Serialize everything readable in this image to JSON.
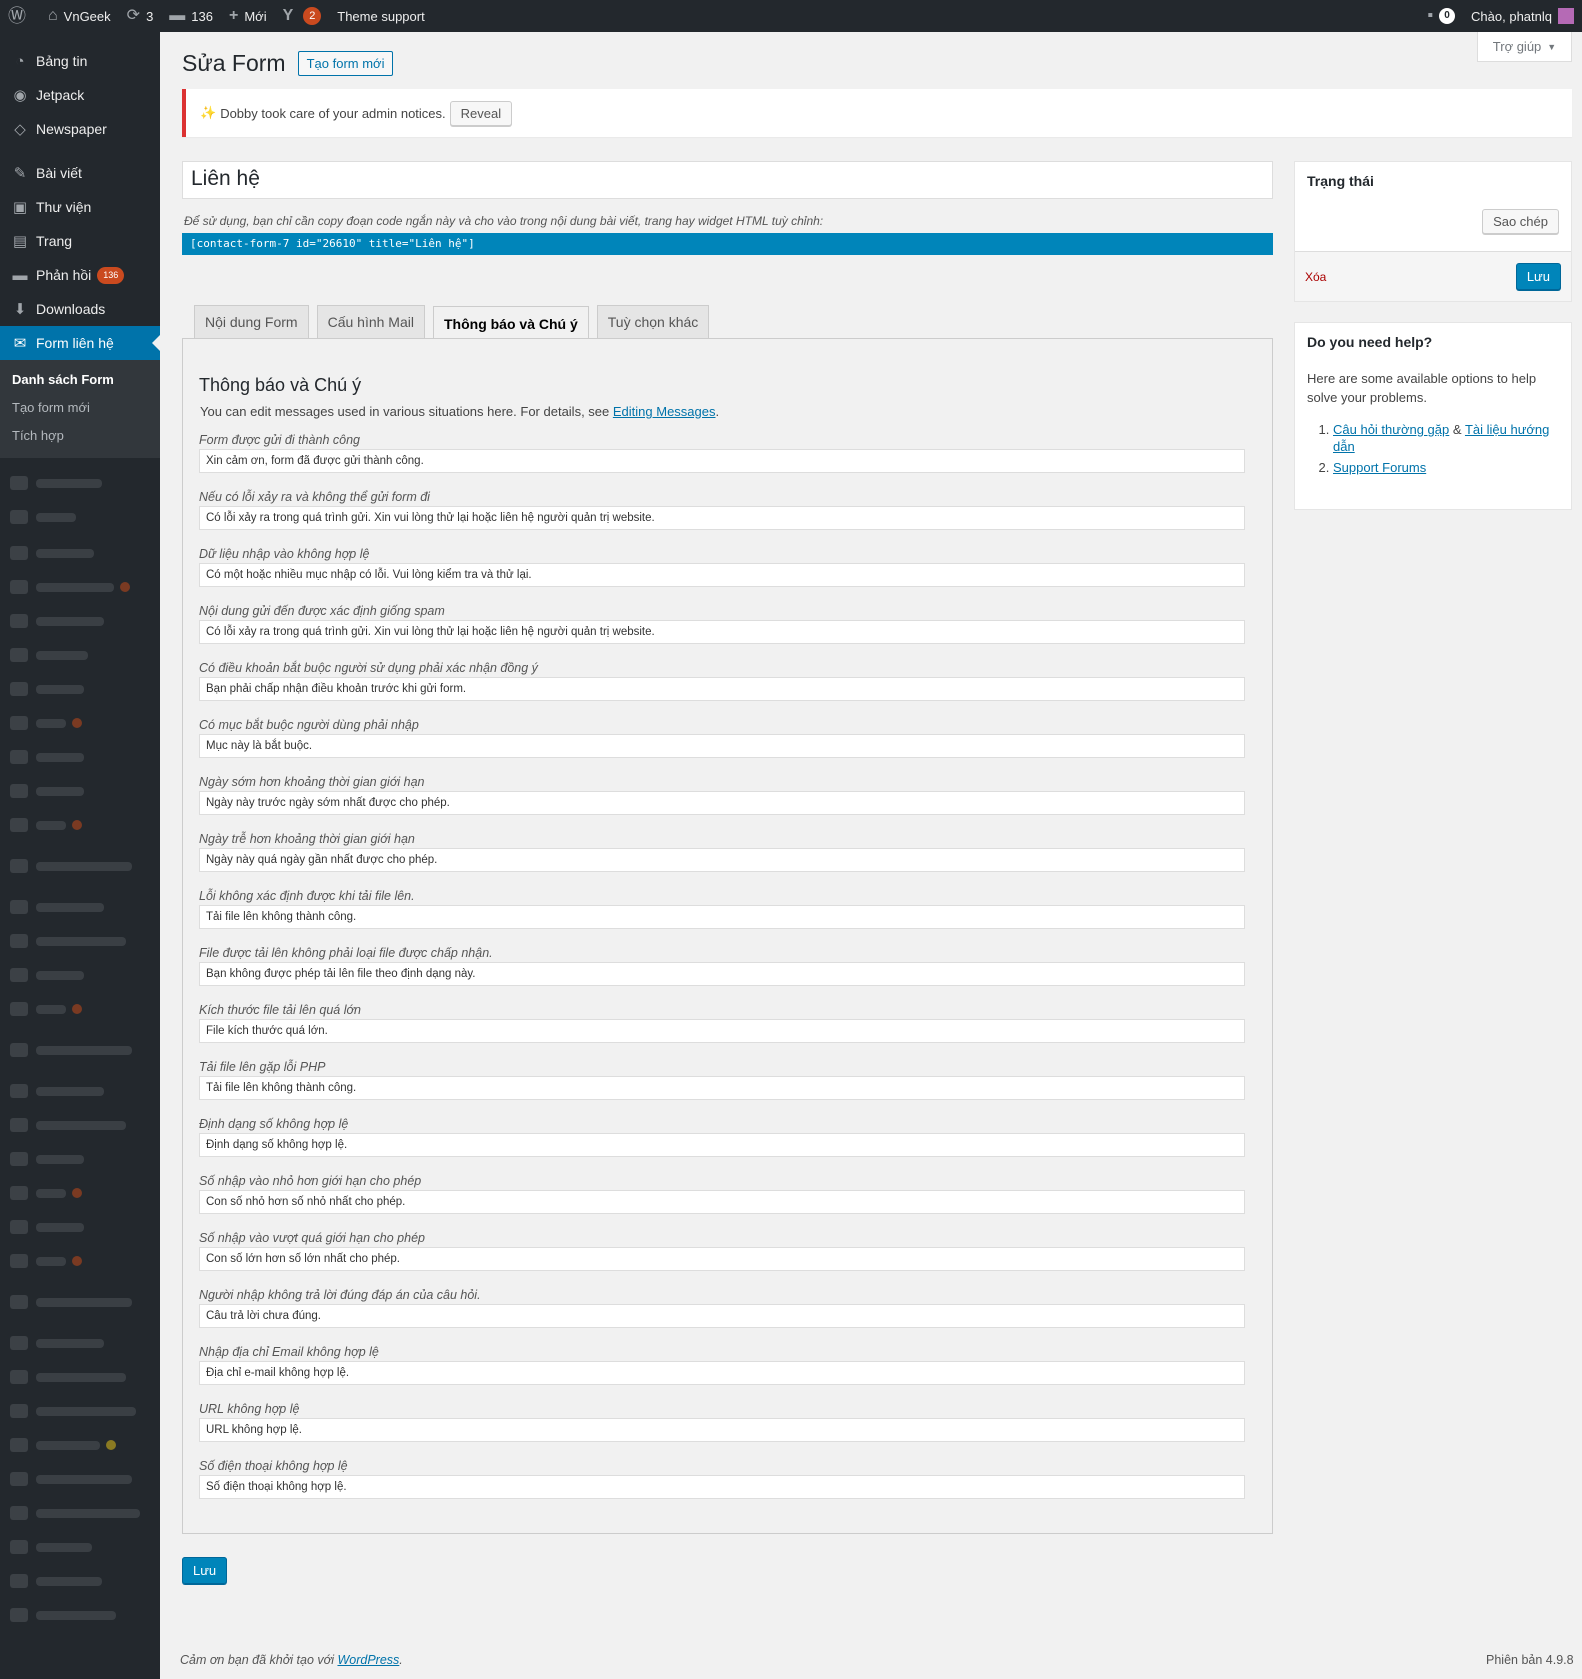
{
  "adminbar": {
    "site_name": "VnGeek",
    "updates_count": "3",
    "comments_count": "136",
    "new_label": "Mới",
    "yoast_count": "2",
    "theme_support": "Theme support",
    "notif_count": "0",
    "greeting": "Chào, phatnlq"
  },
  "sidebar": {
    "items": [
      {
        "label": "Bảng tin",
        "icon": "dashboard-icon"
      },
      {
        "label": "Jetpack",
        "icon": "jetpack-icon"
      },
      {
        "label": "Newspaper",
        "icon": "newspaper-icon"
      },
      {
        "label": "Bài viết",
        "icon": "pin-icon"
      },
      {
        "label": "Thư viện",
        "icon": "media-icon"
      },
      {
        "label": "Trang",
        "icon": "page-icon"
      },
      {
        "label": "Phản hồi",
        "icon": "comment-icon",
        "badge": "136"
      },
      {
        "label": "Downloads",
        "icon": "download-icon"
      },
      {
        "label": "Form liên hệ",
        "icon": "mail-icon"
      }
    ],
    "submenu": [
      "Danh sách Form",
      "Tạo form mới",
      "Tích hợp"
    ]
  },
  "help_tab": "Trợ giúp",
  "page": {
    "title": "Sửa Form",
    "add_new": "Tạo form mới"
  },
  "notice": {
    "text": "Dobby took care of your admin notices.",
    "button": "Reveal"
  },
  "form": {
    "title_value": "Liên hệ",
    "hint": "Để sử dụng, bạn chỉ cần copy đoạn code ngắn này và cho vào trong nội dung bài viết, trang hay widget HTML tuỳ chỉnh:",
    "shortcode": "[contact-form-7 id=\"26610\" title=\"Liên hệ\"]"
  },
  "tabs": [
    "Nội dung Form",
    "Cấu hình Mail",
    "Thông báo và Chú ý",
    "Tuỳ chọn khác"
  ],
  "panel": {
    "heading": "Thông báo và Chú ý",
    "desc": "You can edit messages used in various situations here. For details, see ",
    "desc_link": "Editing Messages",
    "desc_end": ".",
    "fields": [
      {
        "label": "Form được gửi đi thành công",
        "value": "Xin cảm ơn, form đã được gửi thành công."
      },
      {
        "label": "Nếu có lỗi xảy ra và không thể gửi form đi",
        "value": "Có lỗi xảy ra trong quá trình gửi. Xin vui lòng thử lại hoặc liên hệ người quản trị website."
      },
      {
        "label": "Dữ liệu nhập vào không hợp lệ",
        "value": "Có một hoặc nhiều mục nhập có lỗi. Vui lòng kiểm tra và thử lại."
      },
      {
        "label": "Nội dung gửi đến được xác định giống spam",
        "value": "Có lỗi xảy ra trong quá trình gửi. Xin vui lòng thử lại hoặc liên hệ người quản trị website."
      },
      {
        "label": "Có điều khoản bắt buộc người sử dụng phải xác nhận đồng ý",
        "value": "Bạn phải chấp nhận điều khoản trước khi gửi form."
      },
      {
        "label": "Có mục bắt buộc người dùng phải nhập",
        "value": "Mục này là bắt buộc."
      },
      {
        "label": "Ngày sớm hơn khoảng thời gian giới hạn",
        "value": "Ngày này trước ngày sớm nhất được cho phép."
      },
      {
        "label": "Ngày trễ hơn khoảng thời gian giới hạn",
        "value": "Ngày này quá ngày gần nhất được cho phép."
      },
      {
        "label": "Lỗi không xác định được khi tải file lên.",
        "value": "Tải file lên không thành công."
      },
      {
        "label": "File được tải lên không phải loại file được chấp nhận.",
        "value": "Bạn không được phép tải lên file theo định dạng này."
      },
      {
        "label": "Kích thước file tải lên quá lớn",
        "value": "File kích thước quá lớn."
      },
      {
        "label": "Tải file lên gặp lỗi PHP",
        "value": "Tải file lên không thành công."
      },
      {
        "label": "Định dạng số không hợp lệ",
        "value": "Định dạng số không hợp lệ."
      },
      {
        "label": "Số nhập vào nhỏ hơn giới hạn cho phép",
        "value": "Con số nhỏ hơn số nhỏ nhất cho phép."
      },
      {
        "label": "Số nhập vào vượt quá giới hạn cho phép",
        "value": "Con số lớn hơn số lớn nhất cho phép."
      },
      {
        "label": "Người nhập không trả lời đúng đáp án của câu hỏi.",
        "value": "Câu trả lời chưa đúng."
      },
      {
        "label": "Nhập địa chỉ Email không hợp lệ",
        "value": "Địa chỉ e-mail không hợp lệ."
      },
      {
        "label": "URL không hợp lệ",
        "value": "URL không hợp lệ."
      },
      {
        "label": "Số điện thoại không hợp lệ",
        "value": "Số điện thoại không hợp lệ."
      }
    ]
  },
  "save_label": "Lưu",
  "status_box": {
    "title": "Trạng thái",
    "copy_button": "Sao chép",
    "delete_link": "Xóa",
    "save_button": "Lưu"
  },
  "help_box": {
    "title": "Do you need help?",
    "text": "Here are some available options to help solve your problems.",
    "faq_link": "Câu hỏi thường gặp",
    "amp": "&",
    "docs_link": "Tài liệu hướng dẫn",
    "forum_link": "Support Forums"
  },
  "footer": {
    "thanks": "Cảm ơn bạn đã khởi tạo với ",
    "wp_link": "WordPress",
    "thanks_end": ".",
    "version": "Phiên bản 4.9.8"
  },
  "colors": {
    "accent": "#0073aa",
    "primary_button": "#0085ba",
    "admin_dark": "#23282d",
    "badge": "#ca4a1f",
    "notice_red": "#dc3232"
  }
}
